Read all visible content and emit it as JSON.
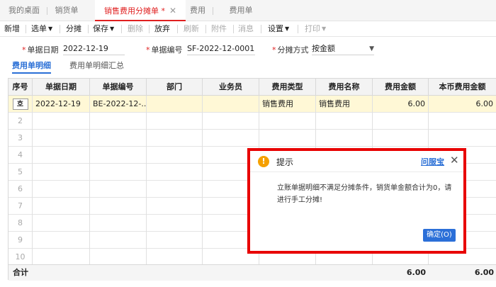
{
  "tabs": [
    {
      "label": "我的桌面"
    },
    {
      "label": "销货单"
    },
    {
      "label": "销售费用分摊单 *",
      "active": true,
      "close": "✕"
    },
    {
      "label": "费用"
    },
    {
      "label": "费用单"
    }
  ],
  "toolbar": {
    "new": "新增",
    "select": "选单",
    "split": "分摊",
    "save": "保存",
    "delete": "删除",
    "discard": "放弃",
    "refresh": "刷新",
    "attach": "附件",
    "message": "消息",
    "settings": "设置",
    "print": "打印"
  },
  "form": {
    "doc_date_label": "单据日期",
    "doc_date": "2022-12-19",
    "doc_no_label": "单据编号",
    "doc_no": "SF-2022-12-0001",
    "method_label": "分摊方式",
    "method": "按金额",
    "required_mark": "*"
  },
  "subtabs": {
    "detail": "费用单明细",
    "summary": "费用单明细汇总"
  },
  "grid": {
    "headers": [
      "序号",
      "单据日期",
      "单据编号",
      "部门",
      "业务员",
      "费用类型",
      "费用名称",
      "费用金额",
      "本币费用金额"
    ],
    "row1": {
      "seq_btn": "호",
      "date": "2022-12-19",
      "doc_no": "BE-2022-12-...",
      "dept": "",
      "staff": "",
      "type": "销售费用",
      "name": "销售费用",
      "amount": "6.00",
      "local_amount": "6.00"
    },
    "row_numbers": [
      "2",
      "3",
      "4",
      "5",
      "6",
      "7",
      "8",
      "9",
      "10"
    ],
    "footer": {
      "label": "合计",
      "amount": "6.00",
      "local_amount": "6.00"
    }
  },
  "dialog": {
    "title": "提示",
    "icon": "!",
    "link": "问服宝",
    "close": "✕",
    "message": "立账单据明细不满足分摊条件，销货单金额合计为0，请进行手工分摊!",
    "ok": "确定(O)"
  },
  "colors": {
    "accent_red": "#e02020",
    "link_blue": "#2a6fd6",
    "highlight_row": "#fff8d6",
    "warning": "#f5a000",
    "dialog_border": "#e80000"
  }
}
